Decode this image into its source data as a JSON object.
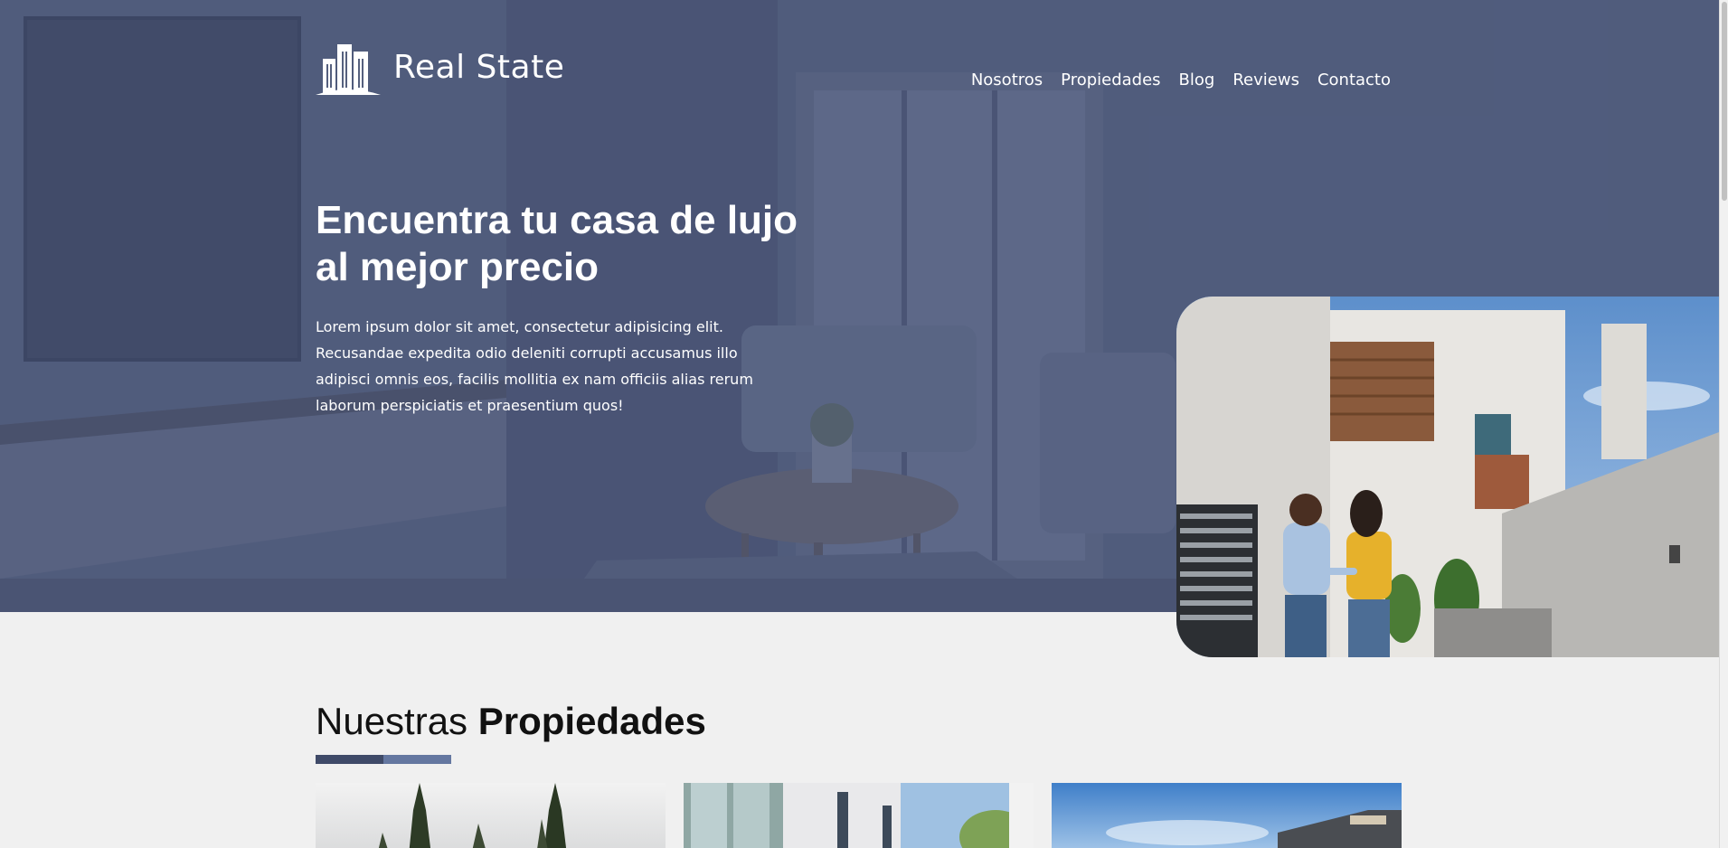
{
  "brand": {
    "name": "Real State",
    "logo_icon": "buildings-icon"
  },
  "nav": {
    "items": [
      {
        "label": "Nosotros"
      },
      {
        "label": "Propiedades"
      },
      {
        "label": "Blog"
      },
      {
        "label": "Reviews"
      },
      {
        "label": "Contacto"
      }
    ]
  },
  "hero": {
    "title": "Encuentra tu casa de lujo al mejor precio",
    "text": "Lorem ipsum dolor sit amet, consectetur adipisicing elit. Recusandae expedita odio deleniti corrupti accusamus illo adipisci omnis eos, facilis mollitia ex nam officiis alias rerum laborum perspiciatis et praesentium quos!",
    "photo_icon": "couple-house-photo"
  },
  "properties": {
    "title_light": "Nuestras",
    "title_bold": "Propiedades",
    "cards": [
      {
        "image": "property-trees-photo"
      },
      {
        "image": "property-modern-building-photo"
      },
      {
        "image": "property-house-sky-photo"
      }
    ]
  },
  "colors": {
    "overlay": "#485475",
    "accent_dark": "#3f4a68",
    "accent_light": "#6477a0",
    "background": "#f0f0f0"
  }
}
